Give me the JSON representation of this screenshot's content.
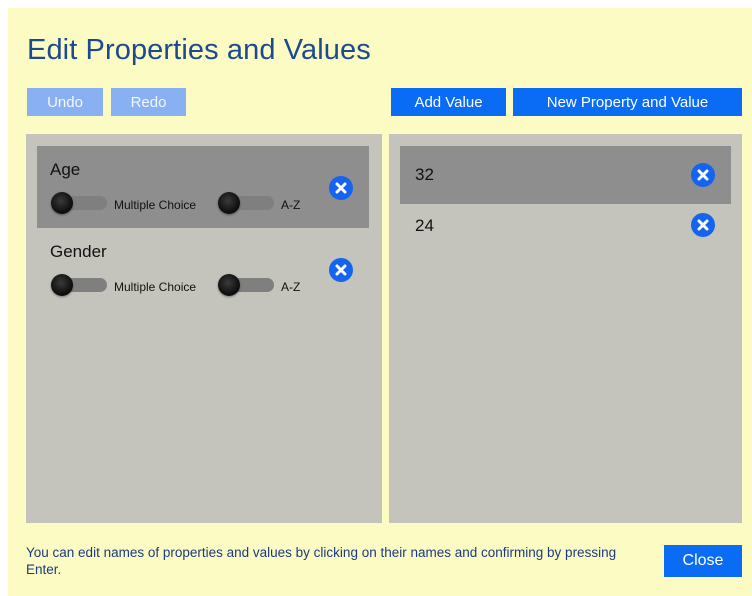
{
  "dialog": {
    "title": "Edit Properties and Values",
    "footer_note": "You can edit names of properties and values by clicking on their names and confirming by pressing Enter.",
    "close_label": "Close"
  },
  "toolbar": {
    "undo_label": "Undo",
    "redo_label": "Redo",
    "add_value_label": "Add Value",
    "new_property_label": "New Property and Value"
  },
  "properties": [
    {
      "name": "Age",
      "multiple_choice_label": "Multiple Choice",
      "sort_label": "A-Z",
      "selected": true,
      "multiple_choice": false,
      "sorted": false
    },
    {
      "name": "Gender",
      "multiple_choice_label": "Multiple Choice",
      "sort_label": "A-Z",
      "selected": false,
      "multiple_choice": false,
      "sorted": false
    }
  ],
  "values": [
    {
      "text": "32",
      "selected": true
    },
    {
      "text": "24",
      "selected": false
    }
  ],
  "colors": {
    "dialog_bg": "#fdfbc4",
    "title": "#1b4a8f",
    "primary_button": "#0a6cf4",
    "disabled_button": "#8ab0f4",
    "panel_bg": "#c4c4bd",
    "selected_row": "#8e8e8e",
    "remove_icon": "#1464f0"
  },
  "icons": {
    "remove": "close-circle-icon"
  }
}
